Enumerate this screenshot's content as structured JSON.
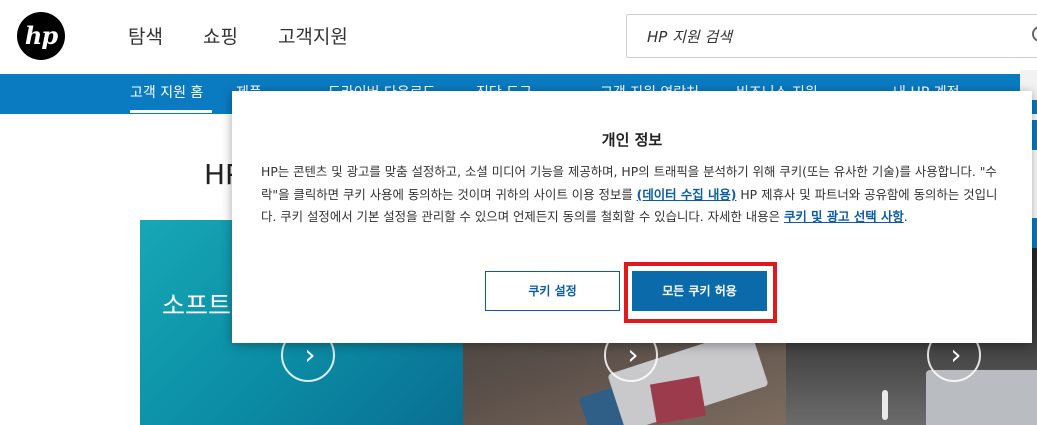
{
  "header": {
    "logo_text": "hp",
    "nav": [
      "탐색",
      "쇼핑",
      "고객지원"
    ],
    "search": {
      "placeholder": "HP 지원 검색"
    }
  },
  "subnav": {
    "items": [
      {
        "label": "고객 지원 홈"
      },
      {
        "label": "제품 ⌄"
      },
      {
        "label": "드라이버 다운로드"
      },
      {
        "label": "진단 도구 ⌄"
      },
      {
        "label": "고객 지원 연락처"
      },
      {
        "label": "비즈니스 지원 ⌄"
      },
      {
        "label": "내 HP 계정 ⌄"
      }
    ]
  },
  "background": {
    "heading_fragment": "HP",
    "card1_title": "소프트",
    "arrow_glyph": "›"
  },
  "dialog": {
    "title": "개인 정보",
    "body_part1": "HP는 콘텐츠 및 광고를 맞춤 설정하고, 소셜 미디어 기능을 제공하며, HP의 트래픽을 분석하기 위해 쿠키(또는 유사한 기술)를 사용합니다. \"수락\"을 클릭하면 쿠키 사용에 동의하는 것이며 귀하의 사이트 이용 정보를 ",
    "link_data": "(데이터 수집 내용)",
    "body_part2": " HP 제휴사 및 파트너와 공유함에 동의하는 것입니다. 쿠키 설정에서 기본 설정을 관리할 수 있으며 언제든지 동의를 철회할 수 있습니다. 자세한 내용은 ",
    "link_policy": "쿠키 및 광고 선택 사항",
    "body_end": ".",
    "btn_settings": "쿠키 설정",
    "btn_accept": "모든 쿠키 허용"
  },
  "colors": {
    "subnav_bg": "#0a7bc1",
    "accept_bg": "#0a6aaa",
    "highlight": "#e0191d"
  }
}
